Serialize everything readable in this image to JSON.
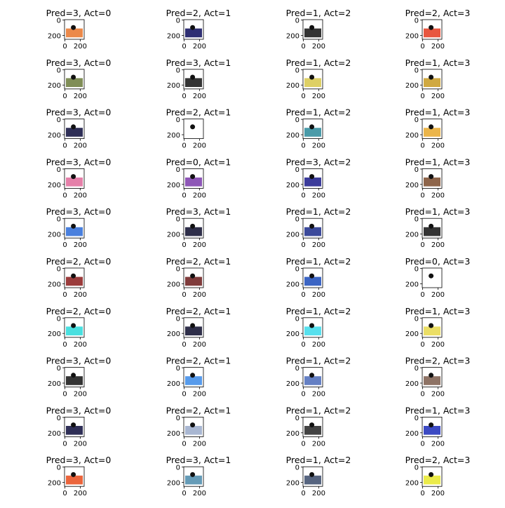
{
  "axis": {
    "xticks": [
      "0",
      "200"
    ],
    "yticks": [
      "0",
      "200"
    ]
  },
  "grid": {
    "rows": 10,
    "cols": 4,
    "titles": [
      [
        "Pred=3, Act=0",
        "Pred=2, Act=1",
        "Pred=1, Act=2",
        "Pred=2, Act=3"
      ],
      [
        "Pred=3, Act=0",
        "Pred=3, Act=1",
        "Pred=1, Act=2",
        "Pred=1, Act=3"
      ],
      [
        "Pred=3, Act=0",
        "Pred=2, Act=1",
        "Pred=1, Act=2",
        "Pred=1, Act=3"
      ],
      [
        "Pred=3, Act=0",
        "Pred=0, Act=1",
        "Pred=3, Act=2",
        "Pred=1, Act=3"
      ],
      [
        "Pred=3, Act=0",
        "Pred=3, Act=1",
        "Pred=1, Act=2",
        "Pred=1, Act=3"
      ],
      [
        "Pred=2, Act=0",
        "Pred=2, Act=1",
        "Pred=1, Act=2",
        "Pred=0, Act=3"
      ],
      [
        "Pred=2, Act=0",
        "Pred=2, Act=1",
        "Pred=1, Act=2",
        "Pred=1, Act=3"
      ],
      [
        "Pred=3, Act=0",
        "Pred=2, Act=1",
        "Pred=1, Act=2",
        "Pred=2, Act=3"
      ],
      [
        "Pred=3, Act=0",
        "Pred=2, Act=1",
        "Pred=1, Act=2",
        "Pred=1, Act=3"
      ],
      [
        "Pred=3, Act=0",
        "Pred=3, Act=1",
        "Pred=1, Act=2",
        "Pred=2, Act=3"
      ]
    ],
    "thumbnail_palettes": [
      [
        "#e8742a",
        "#0a0a5a",
        "#111111",
        "#e43a1f"
      ],
      [
        "#6a7a3a",
        "#111111",
        "#d8c84a",
        "#c89a20"
      ],
      [
        "#0a0a3a",
        "#ffffff",
        "#2a8a9a",
        "#e8a82a"
      ],
      [
        "#e06a9a",
        "#7a3aaa",
        "#1a1a8a",
        "#7a4a2a"
      ],
      [
        "#2a6ad8",
        "#0a0a2a",
        "#1a2a8a",
        "#111111"
      ],
      [
        "#8a1a1a",
        "#6a1a1a",
        "#1a4aba",
        "#ffffff"
      ],
      [
        "#2adada",
        "#0a0a2a",
        "#3adaea",
        "#e8d84a"
      ],
      [
        "#111111",
        "#3a8ae8",
        "#4a6aba",
        "#7a5a4a"
      ],
      [
        "#0a0a3a",
        "#9aaaca",
        "#222222",
        "#1a2ab8"
      ],
      [
        "#e84a1a",
        "#4a8aaa",
        "#3a4a6a",
        "#e8e82a"
      ]
    ]
  }
}
